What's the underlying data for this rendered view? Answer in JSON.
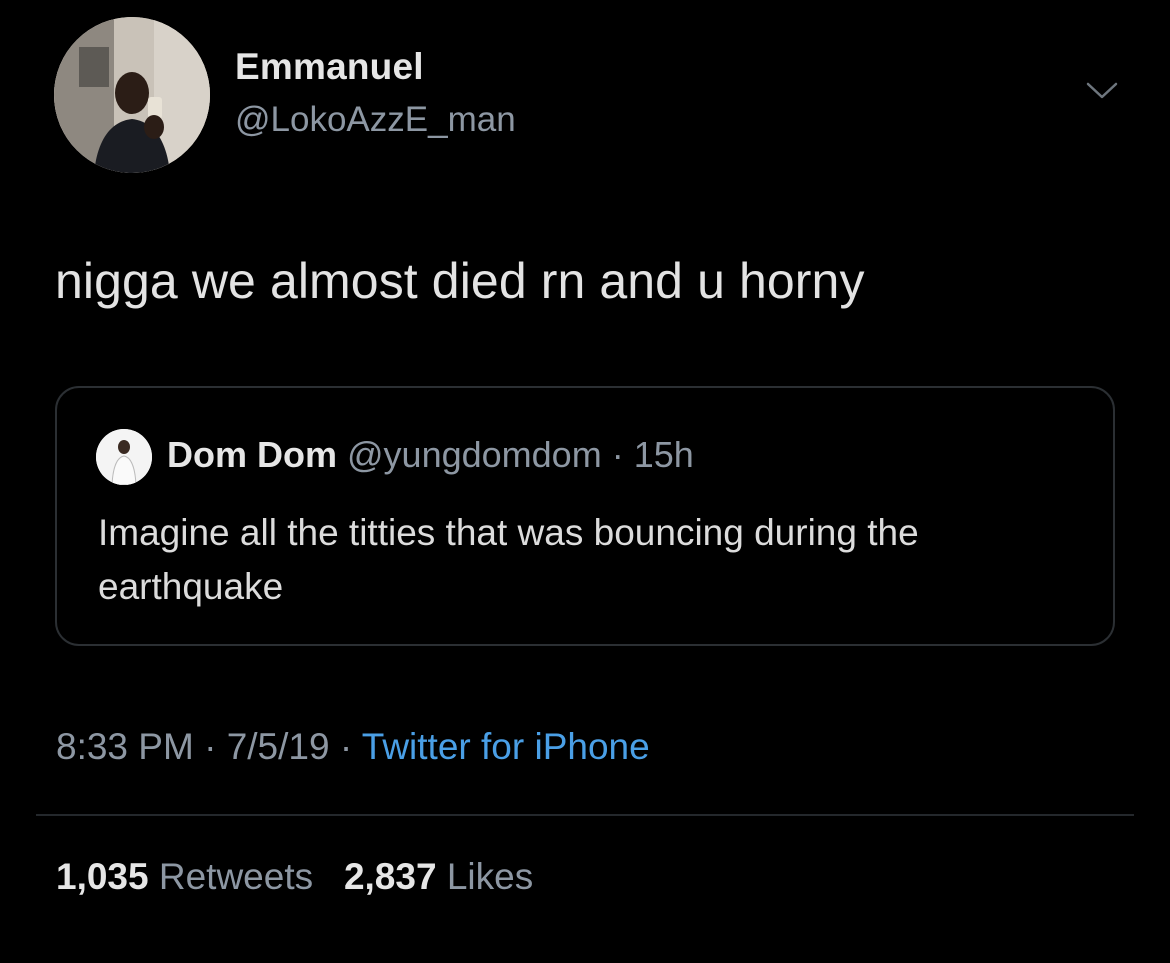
{
  "tweet": {
    "author": {
      "display_name": "Emmanuel",
      "handle": "@LokoAzzE_man"
    },
    "text": "nigga we almost died rn and u horny",
    "menu_icon": "chevron-down-icon"
  },
  "quoted_tweet": {
    "author_name": "Dom Dom",
    "author_handle": "@yungdomdom",
    "separator": "·",
    "time": "15h",
    "text": "Imagine all the titties that was bouncing during the earthquake"
  },
  "meta": {
    "time": "8:33 PM",
    "separator1": " · ",
    "date": "7/5/19",
    "separator2": " · ",
    "source": "Twitter for iPhone"
  },
  "stats": {
    "retweets_count": "1,035",
    "retweets_label": "Retweets",
    "likes_count": "2,837",
    "likes_label": "Likes"
  },
  "colors": {
    "background": "#000000",
    "primary_text": "#e6e6e6",
    "secondary_text": "#8d97a3",
    "link": "#4a9fe6",
    "border": "#2b2f33"
  }
}
